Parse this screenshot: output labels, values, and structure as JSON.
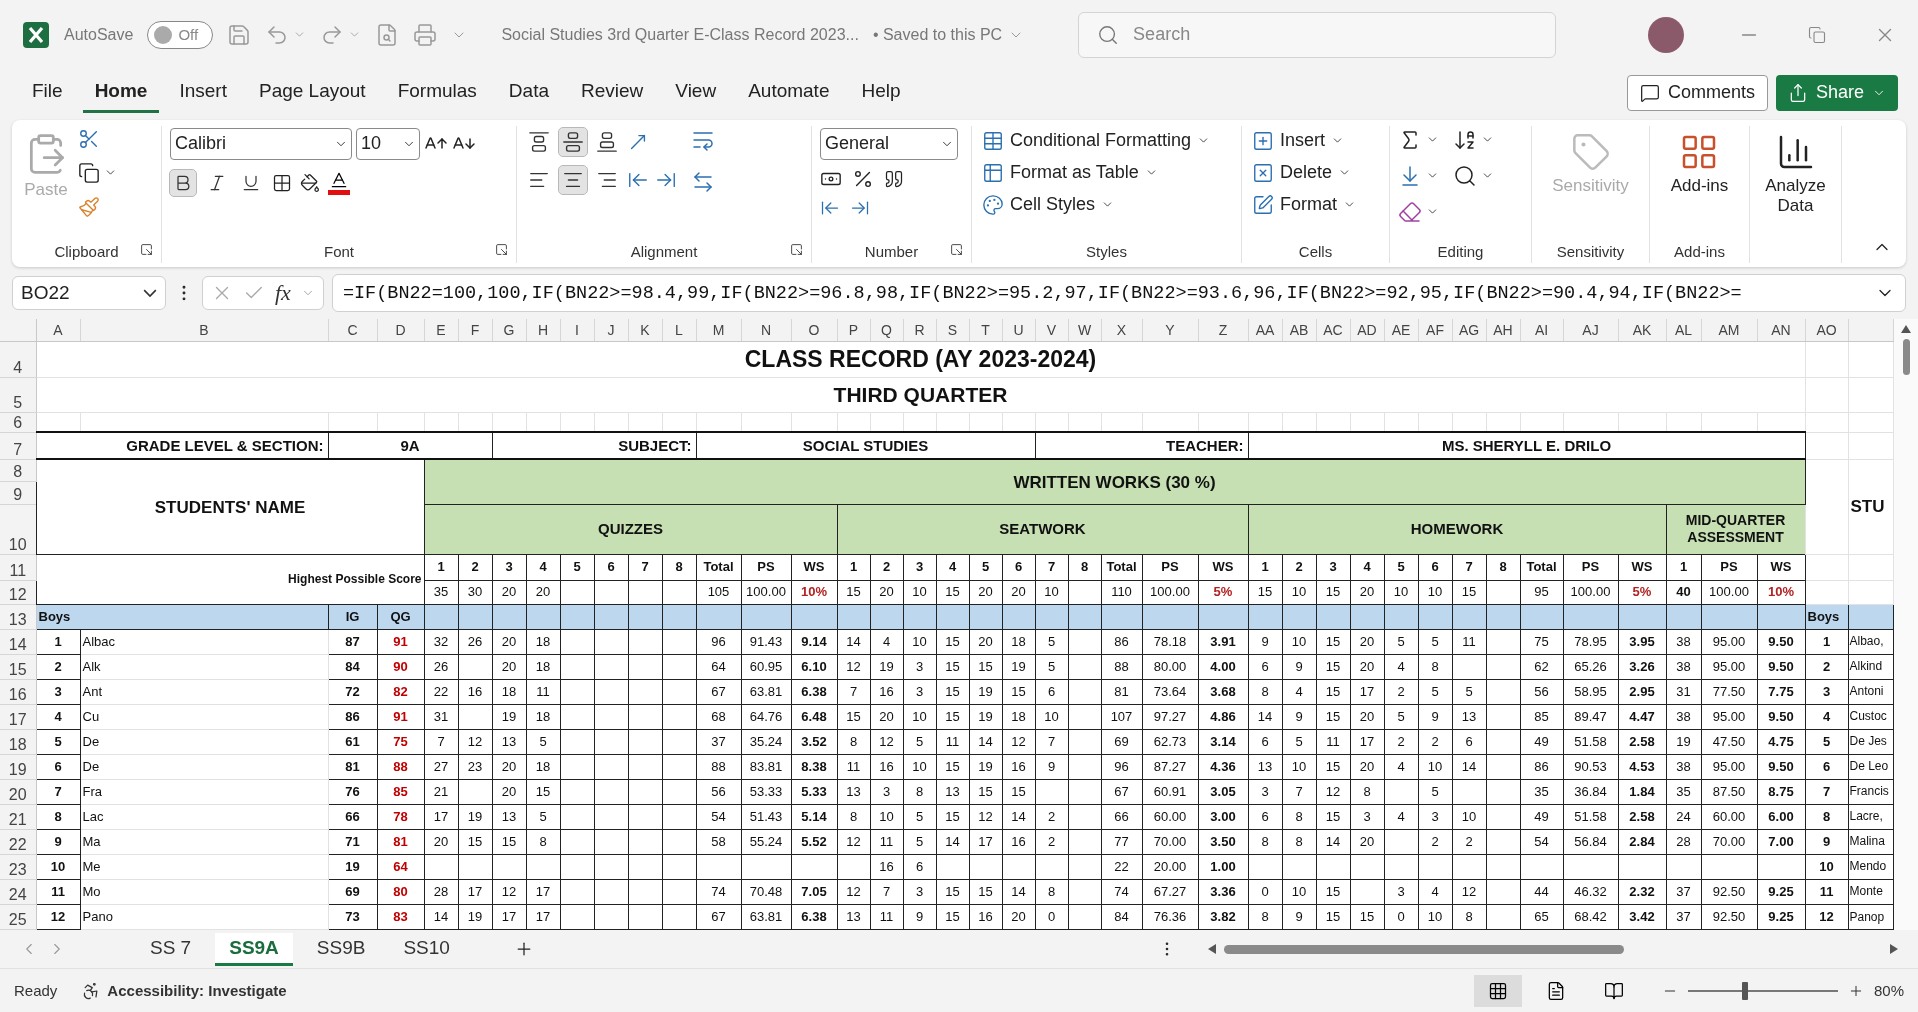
{
  "title_bar": {
    "autosave": {
      "label": "AutoSave",
      "on": false,
      "state_label": "Off"
    },
    "document_title": "Social Studies 3rd Quarter E-Class Record 2023...",
    "save_status": "• Saved to this PC",
    "search": {
      "placeholder": "Search"
    }
  },
  "menu": {
    "tabs": [
      {
        "label": "File",
        "selected": false
      },
      {
        "label": "Home",
        "selected": true
      },
      {
        "label": "Insert",
        "selected": false
      },
      {
        "label": "Page Layout",
        "selected": false
      },
      {
        "label": "Formulas",
        "selected": false
      },
      {
        "label": "Data",
        "selected": false
      },
      {
        "label": "Review",
        "selected": false
      },
      {
        "label": "View",
        "selected": false
      },
      {
        "label": "Automate",
        "selected": false
      },
      {
        "label": "Help",
        "selected": false
      }
    ],
    "comments": "Comments",
    "share": "Share"
  },
  "ribbon": {
    "clipboard": {
      "label": "Clipboard",
      "paste": "Paste"
    },
    "font": {
      "label": "Font",
      "family": "Calibri",
      "size": "10",
      "format_buttons": [
        {
          "kind": "bold",
          "selected": true
        },
        {
          "kind": "italic",
          "selected": false
        },
        {
          "kind": "underline",
          "selected": false
        }
      ]
    },
    "alignment": {
      "label": "Alignment",
      "buttons": [
        {
          "kind": "top",
          "selected": false
        },
        {
          "kind": "middle",
          "selected": true
        },
        {
          "kind": "bottom",
          "selected": false
        },
        {
          "kind": "left",
          "selected": false
        },
        {
          "kind": "center",
          "selected": true
        },
        {
          "kind": "right",
          "selected": false
        }
      ]
    },
    "number": {
      "label": "Number",
      "format": "General"
    },
    "styles": {
      "label": "Styles",
      "items": [
        "Conditional Formatting",
        "Format as Table",
        "Cell Styles"
      ]
    },
    "cells": {
      "label": "Cells",
      "items": [
        "Insert",
        "Delete",
        "Format"
      ]
    },
    "editing": {
      "label": "Editing"
    },
    "sensitivity": {
      "label": "Sensitivity",
      "button": "Sensitivity",
      "disabled": true
    },
    "addins": {
      "label": "Add-ins",
      "button": "Add-ins"
    },
    "analyze": {
      "button": "Analyze Data"
    }
  },
  "formula_bar": {
    "name_box": "BO22",
    "fx_label": "fx",
    "formula": "=IF(BN22=100,100,IF(BN22>=98.4,99,IF(BN22>=96.8,98,IF(BN22>=95.2,97,IF(BN22>=93.6,96,IF(BN22>=92,95,IF(BN22>=90.4,94,IF(BN22>="
  },
  "sheet": {
    "column_letters": [
      "A",
      "B",
      "C",
      "D",
      "E",
      "F",
      "G",
      "H",
      "I",
      "J",
      "K",
      "L",
      "M",
      "N",
      "O",
      "P",
      "Q",
      "R",
      "S",
      "T",
      "U",
      "V",
      "W",
      "X",
      "Y",
      "Z",
      "AA",
      "AB",
      "AC",
      "AD",
      "AE",
      "AF",
      "AG",
      "AH",
      "AI",
      "AJ",
      "AK",
      "AL",
      "AM",
      "AN",
      "AO"
    ],
    "row_numbers": [
      "4",
      "5",
      "6",
      "7",
      "8",
      "9",
      "10",
      "11",
      "12",
      "13",
      "14",
      "15",
      "16",
      "17",
      "18",
      "19",
      "20",
      "21",
      "22",
      "23",
      "24",
      "25"
    ],
    "title": "CLASS RECORD (AY 2023-2024)",
    "subtitle": "THIRD QUARTER",
    "info": [
      {
        "label": "GRADE LEVEL & SECTION:",
        "value": "9A"
      },
      {
        "label": "SUBJECT:",
        "value": "SOCIAL STUDIES"
      },
      {
        "label": "TEACHER:",
        "value": "MS. SHERYLL E. DRILO"
      }
    ],
    "names_header": "STUDENTS' NAME",
    "written_works": "WRITTEN WORKS (30 %)",
    "hps_label": "Highest Possible Score",
    "section_label": "Boys",
    "ig_label": "IG",
    "qg_label": "QG",
    "groups": [
      {
        "title": "QUIZZES",
        "items": [
          "1",
          "2",
          "3",
          "4",
          "5",
          "6",
          "7",
          "8"
        ],
        "total_label": "Total",
        "ps_label": "PS",
        "ws_label": "WS",
        "hps": {
          "1": "35",
          "2": "30",
          "3": "20",
          "4": "20"
        },
        "hps_total": "105",
        "hps_ps": "100.00",
        "hps_ws": "10%"
      },
      {
        "title": "SEATWORK",
        "items": [
          "1",
          "2",
          "3",
          "4",
          "5",
          "6",
          "7",
          "8"
        ],
        "total_label": "Total",
        "ps_label": "PS",
        "ws_label": "WS",
        "hps": {
          "1": "15",
          "2": "20",
          "3": "10",
          "4": "15",
          "5": "20",
          "6": "20",
          "7": "10"
        },
        "hps_total": "110",
        "hps_ps": "100.00",
        "hps_ws": "5%"
      },
      {
        "title": "HOMEWORK",
        "items": [
          "1",
          "2",
          "3",
          "4",
          "5",
          "6",
          "7",
          "8"
        ],
        "total_label": "Total",
        "ps_label": "PS",
        "ws_label": "WS",
        "hps": {
          "1": "15",
          "2": "10",
          "3": "15",
          "4": "20",
          "5": "10",
          "6": "10",
          "7": "15"
        },
        "hps_total": "95",
        "hps_ps": "100.00",
        "hps_ws": "5%"
      }
    ],
    "mid_quarter": {
      "title": "MID-QUARTER ASSESSMENT",
      "item": "1",
      "ps_label": "PS",
      "ws_label": "WS",
      "hps": "40",
      "hps_ps": "100.00",
      "hps_ws": "10%"
    },
    "students": [
      {
        "no": "1",
        "name": "Albac",
        "ig": "87",
        "qg": "91",
        "quiz": {
          "scores": {
            "1": "32",
            "2": "26",
            "3": "20",
            "4": "18"
          },
          "total": "96",
          "ps": "91.43",
          "ws": "9.14"
        },
        "seatwork": {
          "scores": {
            "1": "14",
            "2": "4",
            "3": "10",
            "4": "15",
            "5": "20",
            "6": "18",
            "7": "5"
          },
          "total": "86",
          "ps": "78.18",
          "ws": "3.91"
        },
        "homework": {
          "scores": {
            "1": "9",
            "2": "10",
            "3": "15",
            "4": "20",
            "5": "5",
            "6": "5",
            "7": "11"
          },
          "total": "75",
          "ps": "78.95",
          "ws": "3.95"
        },
        "mid_quarter": {
          "score": "38",
          "ps": "95.00",
          "ws": "9.50"
        }
      },
      {
        "no": "2",
        "name": "Alk",
        "ig": "84",
        "qg": "90",
        "quiz": {
          "scores": {
            "1": "26",
            "3": "20",
            "4": "18"
          },
          "total": "64",
          "ps": "60.95",
          "ws": "6.10"
        },
        "seatwork": {
          "scores": {
            "1": "12",
            "2": "19",
            "3": "3",
            "4": "15",
            "5": "15",
            "6": "19",
            "7": "5"
          },
          "total": "88",
          "ps": "80.00",
          "ws": "4.00"
        },
        "homework": {
          "scores": {
            "1": "6",
            "2": "9",
            "3": "15",
            "4": "20",
            "5": "4",
            "6": "8"
          },
          "total": "62",
          "ps": "65.26",
          "ws": "3.26"
        },
        "mid_quarter": {
          "score": "38",
          "ps": "95.00",
          "ws": "9.50"
        }
      },
      {
        "no": "3",
        "name": "Ant",
        "ig": "72",
        "qg": "82",
        "quiz": {
          "scores": {
            "1": "22",
            "2": "16",
            "3": "18",
            "4": "11"
          },
          "total": "67",
          "ps": "63.81",
          "ws": "6.38"
        },
        "seatwork": {
          "scores": {
            "1": "7",
            "2": "16",
            "3": "3",
            "4": "15",
            "5": "19",
            "6": "15",
            "7": "6"
          },
          "total": "81",
          "ps": "73.64",
          "ws": "3.68"
        },
        "homework": {
          "scores": {
            "1": "8",
            "2": "4",
            "3": "15",
            "4": "17",
            "5": "2",
            "6": "5",
            "7": "5"
          },
          "total": "56",
          "ps": "58.95",
          "ws": "2.95"
        },
        "mid_quarter": {
          "score": "31",
          "ps": "77.50",
          "ws": "7.75"
        }
      },
      {
        "no": "4",
        "name": "Cu",
        "ig": "86",
        "qg": "91",
        "quiz": {
          "scores": {
            "1": "31",
            "3": "19",
            "4": "18"
          },
          "total": "68",
          "ps": "64.76",
          "ws": "6.48"
        },
        "seatwork": {
          "scores": {
            "1": "15",
            "2": "20",
            "3": "10",
            "4": "15",
            "5": "19",
            "6": "18",
            "7": "10"
          },
          "total": "107",
          "ps": "97.27",
          "ws": "4.86"
        },
        "homework": {
          "scores": {
            "1": "14",
            "2": "9",
            "3": "15",
            "4": "20",
            "5": "5",
            "6": "9",
            "7": "13"
          },
          "total": "85",
          "ps": "89.47",
          "ws": "4.47"
        },
        "mid_quarter": {
          "score": "38",
          "ps": "95.00",
          "ws": "9.50"
        }
      },
      {
        "no": "5",
        "name": "De",
        "ig": "61",
        "qg": "75",
        "quiz": {
          "scores": {
            "1": "7",
            "2": "12",
            "3": "13",
            "4": "5"
          },
          "total": "37",
          "ps": "35.24",
          "ws": "3.52"
        },
        "seatwork": {
          "scores": {
            "1": "8",
            "2": "12",
            "3": "5",
            "4": "11",
            "5": "14",
            "6": "12",
            "7": "7"
          },
          "total": "69",
          "ps": "62.73",
          "ws": "3.14"
        },
        "homework": {
          "scores": {
            "1": "6",
            "2": "5",
            "3": "11",
            "4": "17",
            "5": "2",
            "6": "2",
            "7": "6"
          },
          "total": "49",
          "ps": "51.58",
          "ws": "2.58"
        },
        "mid_quarter": {
          "score": "19",
          "ps": "47.50",
          "ws": "4.75"
        }
      },
      {
        "no": "6",
        "name": "De",
        "ig": "81",
        "qg": "88",
        "quiz": {
          "scores": {
            "1": "27",
            "2": "23",
            "3": "20",
            "4": "18"
          },
          "total": "88",
          "ps": "83.81",
          "ws": "8.38"
        },
        "seatwork": {
          "scores": {
            "1": "11",
            "2": "16",
            "3": "10",
            "4": "15",
            "5": "19",
            "6": "16",
            "7": "9"
          },
          "total": "96",
          "ps": "87.27",
          "ws": "4.36"
        },
        "homework": {
          "scores": {
            "1": "13",
            "2": "10",
            "3": "15",
            "4": "20",
            "5": "4",
            "6": "10",
            "7": "14"
          },
          "total": "86",
          "ps": "90.53",
          "ws": "4.53"
        },
        "mid_quarter": {
          "score": "38",
          "ps": "95.00",
          "ws": "9.50"
        }
      },
      {
        "no": "7",
        "name": "Fra",
        "ig": "76",
        "qg": "85",
        "quiz": {
          "scores": {
            "1": "21",
            "3": "20",
            "4": "15"
          },
          "total": "56",
          "ps": "53.33",
          "ws": "5.33"
        },
        "seatwork": {
          "scores": {
            "1": "13",
            "2": "3",
            "3": "8",
            "4": "13",
            "5": "15",
            "6": "15"
          },
          "total": "67",
          "ps": "60.91",
          "ws": "3.05"
        },
        "homework": {
          "scores": {
            "1": "3",
            "2": "7",
            "3": "12",
            "4": "8",
            "6": "5"
          },
          "total": "35",
          "ps": "36.84",
          "ws": "1.84"
        },
        "mid_quarter": {
          "score": "35",
          "ps": "87.50",
          "ws": "8.75"
        }
      },
      {
        "no": "8",
        "name": "Lac",
        "ig": "66",
        "qg": "78",
        "quiz": {
          "scores": {
            "1": "17",
            "2": "19",
            "3": "13",
            "4": "5"
          },
          "total": "54",
          "ps": "51.43",
          "ws": "5.14"
        },
        "seatwork": {
          "scores": {
            "1": "8",
            "2": "10",
            "3": "5",
            "4": "15",
            "5": "12",
            "6": "14",
            "7": "2"
          },
          "total": "66",
          "ps": "60.00",
          "ws": "3.00"
        },
        "homework": {
          "scores": {
            "1": "6",
            "2": "8",
            "3": "15",
            "4": "3",
            "5": "4",
            "6": "3",
            "7": "10"
          },
          "total": "49",
          "ps": "51.58",
          "ws": "2.58"
        },
        "mid_quarter": {
          "score": "24",
          "ps": "60.00",
          "ws": "6.00"
        }
      },
      {
        "no": "9",
        "name": "Ma",
        "ig": "71",
        "qg": "81",
        "quiz": {
          "scores": {
            "1": "20",
            "2": "15",
            "3": "15",
            "4": "8"
          },
          "total": "58",
          "ps": "55.24",
          "ws": "5.52"
        },
        "seatwork": {
          "scores": {
            "1": "12",
            "2": "11",
            "3": "5",
            "4": "14",
            "5": "17",
            "6": "16",
            "7": "2"
          },
          "total": "77",
          "ps": "70.00",
          "ws": "3.50"
        },
        "homework": {
          "scores": {
            "1": "8",
            "2": "8",
            "3": "14",
            "4": "20",
            "6": "2",
            "7": "2"
          },
          "total": "54",
          "ps": "56.84",
          "ws": "2.84"
        },
        "mid_quarter": {
          "score": "28",
          "ps": "70.00",
          "ws": "7.00"
        }
      },
      {
        "no": "10",
        "name": "Me",
        "ig": "19",
        "qg": "64",
        "seatwork": {
          "scores": {
            "2": "16",
            "3": "6"
          },
          "total": "22",
          "ps": "20.00",
          "ws": "1.00"
        }
      },
      {
        "no": "11",
        "name": "Mo",
        "ig": "69",
        "qg": "80",
        "quiz": {
          "scores": {
            "1": "28",
            "2": "17",
            "3": "12",
            "4": "17"
          },
          "total": "74",
          "ps": "70.48",
          "ws": "7.05"
        },
        "seatwork": {
          "scores": {
            "1": "12",
            "2": "7",
            "3": "3",
            "4": "15",
            "5": "15",
            "6": "14",
            "7": "8"
          },
          "total": "74",
          "ps": "67.27",
          "ws": "3.36"
        },
        "homework": {
          "scores": {
            "1": "0",
            "2": "10",
            "3": "15",
            "5": "3",
            "6": "4",
            "7": "12"
          },
          "total": "44",
          "ps": "46.32",
          "ws": "2.32"
        },
        "mid_quarter": {
          "score": "37",
          "ps": "92.50",
          "ws": "9.25"
        }
      },
      {
        "no": "12",
        "name": "Pano",
        "ig": "73",
        "qg": "83",
        "quiz": {
          "scores": {
            "1": "14",
            "2": "19",
            "3": "17",
            "4": "17"
          },
          "total": "67",
          "ps": "63.81",
          "ws": "6.38"
        },
        "seatwork": {
          "scores": {
            "1": "13",
            "2": "11",
            "3": "9",
            "4": "15",
            "5": "16",
            "6": "20",
            "7": "0"
          },
          "total": "84",
          "ps": "76.36",
          "ws": "3.82"
        },
        "homework": {
          "scores": {
            "1": "8",
            "2": "9",
            "3": "15",
            "4": "15",
            "5": "0",
            "6": "10",
            "7": "8"
          },
          "total": "65",
          "ps": "68.42",
          "ws": "3.42"
        },
        "mid_quarter": {
          "score": "37",
          "ps": "92.50",
          "ws": "9.25"
        }
      }
    ],
    "next_block": {
      "header": "STU",
      "section": "Boys",
      "rows": [
        {
          "no": "1",
          "name": "Albao,"
        },
        {
          "no": "2",
          "name": "Alkind"
        },
        {
          "no": "3",
          "name": "Antoni"
        },
        {
          "no": "4",
          "name": "Custoc"
        },
        {
          "no": "5",
          "name": "De Jes"
        },
        {
          "no": "6",
          "name": "De Leo"
        },
        {
          "no": "7",
          "name": "Francis"
        },
        {
          "no": "8",
          "name": "Lacre,"
        },
        {
          "no": "9",
          "name": "Malina"
        },
        {
          "no": "10",
          "name": "Mendo"
        },
        {
          "no": "11",
          "name": "Monte"
        },
        {
          "no": "12",
          "name": "Panop"
        }
      ]
    }
  },
  "sheet_tabs": [
    {
      "label": "SS 7",
      "selected": false
    },
    {
      "label": "SS9A",
      "selected": true
    },
    {
      "label": "SS9B",
      "selected": false
    },
    {
      "label": "SS10",
      "selected": false
    }
  ],
  "status_bar": {
    "ready": "Ready",
    "accessibility": "Accessibility: Investigate",
    "zoom": {
      "level": 0.38,
      "label": "80%"
    }
  }
}
